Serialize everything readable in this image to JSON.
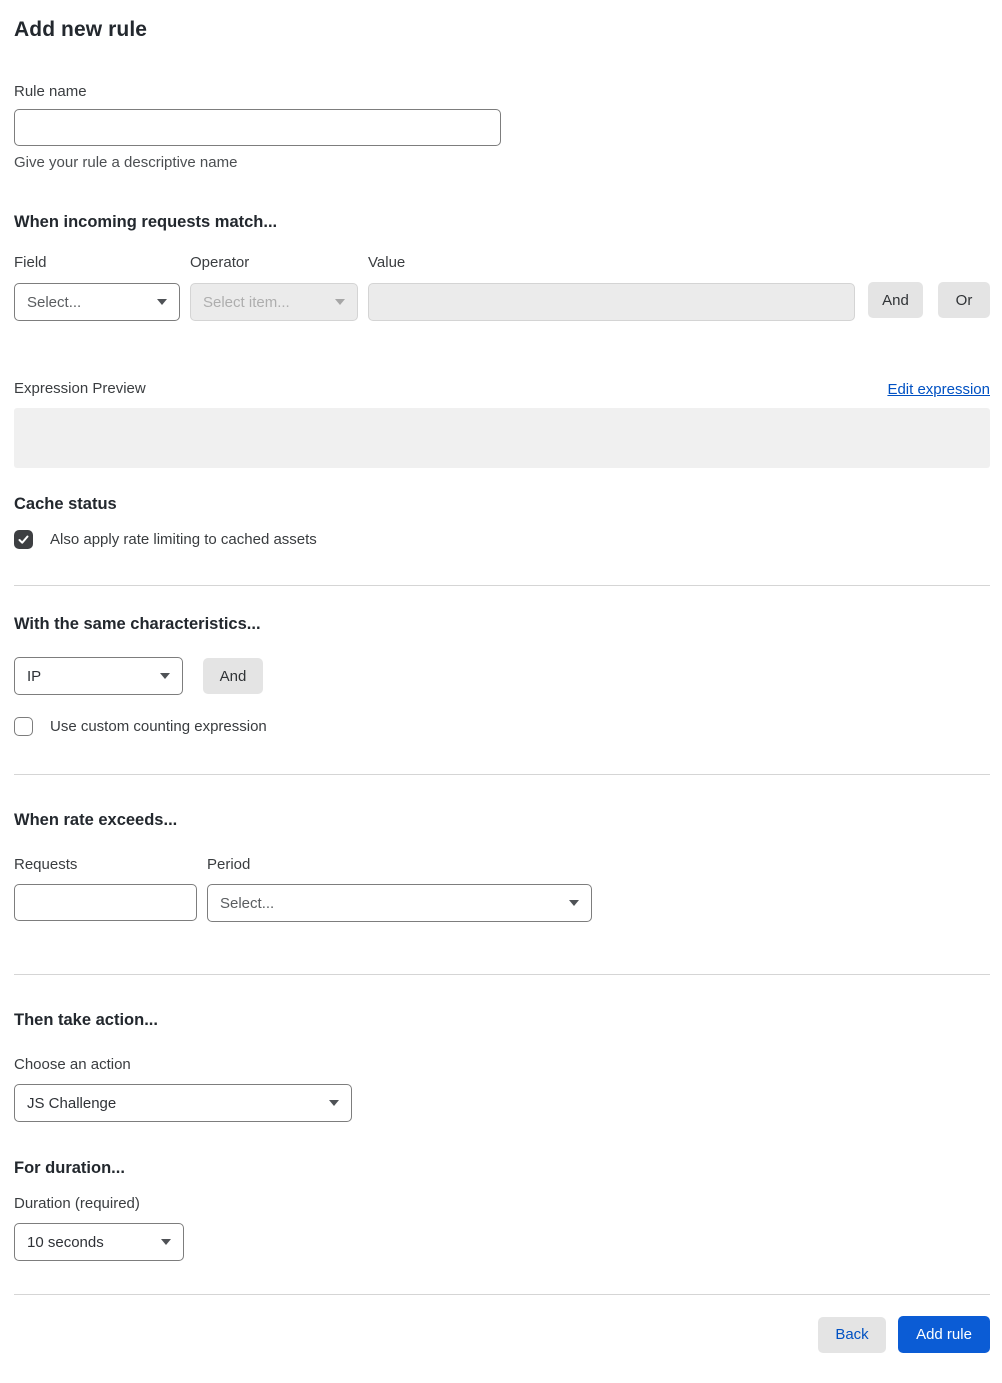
{
  "page": {
    "title": "Add new rule"
  },
  "rule_name": {
    "label": "Rule name",
    "value": "",
    "helper": "Give your rule a descriptive name"
  },
  "match_section": {
    "heading": "When incoming requests match...",
    "field": {
      "label": "Field",
      "selected": "Select..."
    },
    "operator": {
      "label": "Operator",
      "selected": "Select item...",
      "disabled": true
    },
    "value": {
      "label": "Value",
      "value": "",
      "disabled": true
    },
    "and_button": "And",
    "or_button": "Or",
    "expression_preview": {
      "label": "Expression Preview",
      "edit_link": "Edit expression",
      "content": ""
    }
  },
  "cache_section": {
    "heading": "Cache status",
    "checkbox_label": "Also apply rate limiting to cached assets",
    "checked": true
  },
  "characteristics_section": {
    "heading": "With the same characteristics...",
    "select_value": "IP",
    "and_button": "And",
    "checkbox_label": "Use custom counting expression",
    "checked": false
  },
  "rate_section": {
    "heading": "When rate exceeds...",
    "requests": {
      "label": "Requests",
      "value": ""
    },
    "period": {
      "label": "Period",
      "selected": "Select..."
    }
  },
  "action_section": {
    "heading": "Then take action...",
    "label": "Choose an action",
    "selected": "JS Challenge"
  },
  "duration_section": {
    "heading": "For duration...",
    "label": "Duration (required)",
    "selected": "10 seconds"
  },
  "footer": {
    "back_label": "Back",
    "add_label": "Add rule"
  },
  "colors": {
    "link_blue": "#0051c3",
    "primary_button_blue": "#0b5cd5",
    "checkbox_checked_dark": "#3d3f42",
    "disabled_control_bg": "#ebebeb",
    "divider_gray": "#d5d5d5",
    "preview_box_gray": "#f0f0f0"
  },
  "icons": {
    "chevron_down": "chevron-down-icon",
    "checkmark": "checkmark-icon"
  }
}
